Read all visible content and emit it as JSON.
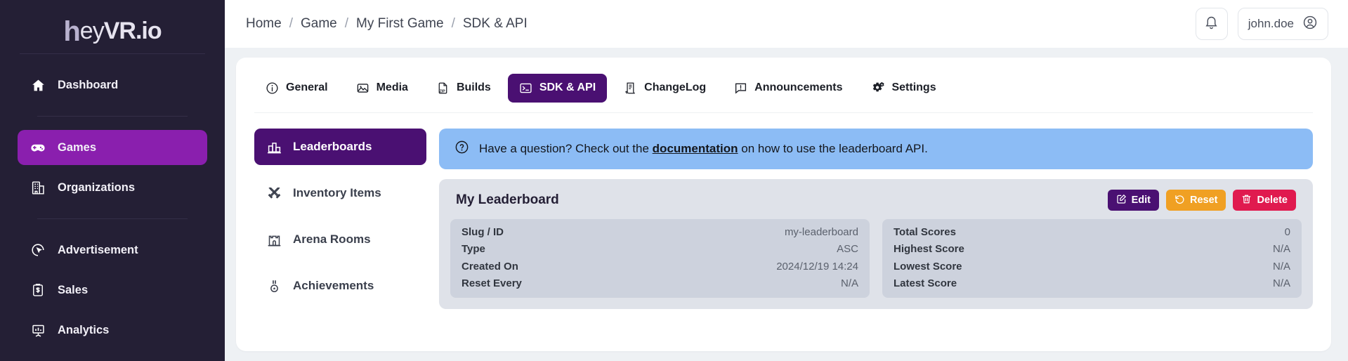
{
  "brand": {
    "logo_h": "h",
    "logo_ey": "ey",
    "logo_vr": "VR.io"
  },
  "sidebar": {
    "groups": [
      {
        "items": [
          {
            "label": "Dashboard",
            "icon": "home-icon",
            "active": false
          }
        ]
      },
      {
        "items": [
          {
            "label": "Games",
            "icon": "gamepad-icon",
            "active": true
          },
          {
            "label": "Organizations",
            "icon": "building-icon",
            "active": false
          }
        ]
      },
      {
        "items": [
          {
            "label": "Advertisement",
            "icon": "ad-click-icon",
            "active": false
          },
          {
            "label": "Sales",
            "icon": "clipboard-dollar-icon",
            "active": false
          },
          {
            "label": "Analytics",
            "icon": "analytics-board-icon",
            "active": false
          }
        ]
      }
    ]
  },
  "topbar": {
    "breadcrumbs": [
      "Home",
      "Game",
      "My First Game",
      "SDK & API"
    ],
    "separator": "/",
    "notification_icon": "bell-icon",
    "user_name": "john.doe",
    "user_icon": "user-circle-icon"
  },
  "tabs": [
    {
      "label": "General",
      "icon": "info-circle-icon",
      "active": false
    },
    {
      "label": "Media",
      "icon": "image-icon",
      "active": false
    },
    {
      "label": "Builds",
      "icon": "zip-file-icon",
      "active": false
    },
    {
      "label": "SDK & API",
      "icon": "terminal-icon",
      "active": true
    },
    {
      "label": "ChangeLog",
      "icon": "scroll-icon",
      "active": false
    },
    {
      "label": "Announcements",
      "icon": "megaphone-icon",
      "active": false
    },
    {
      "label": "Settings",
      "icon": "gears-icon",
      "active": false
    }
  ],
  "subnav": [
    {
      "label": "Leaderboards",
      "icon": "podium-icon",
      "active": true
    },
    {
      "label": "Inventory Items",
      "icon": "swords-icon",
      "active": false
    },
    {
      "label": "Arena Rooms",
      "icon": "castle-icon",
      "active": false
    },
    {
      "label": "Achievements",
      "icon": "medal-icon",
      "active": false
    }
  ],
  "banner": {
    "icon": "question-circle-icon",
    "text_before": "Have a question? Check out the ",
    "link_text": "documentation",
    "text_after": " on how to use the leaderboard API."
  },
  "leaderboard": {
    "title": "My Leaderboard",
    "actions": [
      {
        "label": "Edit",
        "icon": "pencil-square-icon",
        "color": "#4a1072"
      },
      {
        "label": "Reset",
        "icon": "reset-arrow-icon",
        "color": "#f0a023"
      },
      {
        "label": "Delete",
        "icon": "trash-icon",
        "color": "#e01a4f"
      }
    ],
    "details_left": [
      {
        "key": "Slug / ID",
        "value": "my-leaderboard"
      },
      {
        "key": "Type",
        "value": "ASC"
      },
      {
        "key": "Created On",
        "value": "2024/12/19 14:24"
      },
      {
        "key": "Reset Every",
        "value": "N/A"
      }
    ],
    "details_right": [
      {
        "key": "Total Scores",
        "value": "0"
      },
      {
        "key": "Highest Score",
        "value": "N/A"
      },
      {
        "key": "Lowest Score",
        "value": "N/A"
      },
      {
        "key": "Latest Score",
        "value": "N/A"
      }
    ]
  },
  "colors": {
    "sidebar_bg": "#241f35",
    "accent_purple": "#8a1fae",
    "deep_purple": "#4a1072",
    "banner_blue": "#8cbcf5",
    "orange": "#f0a023",
    "red": "#e01a4f"
  }
}
